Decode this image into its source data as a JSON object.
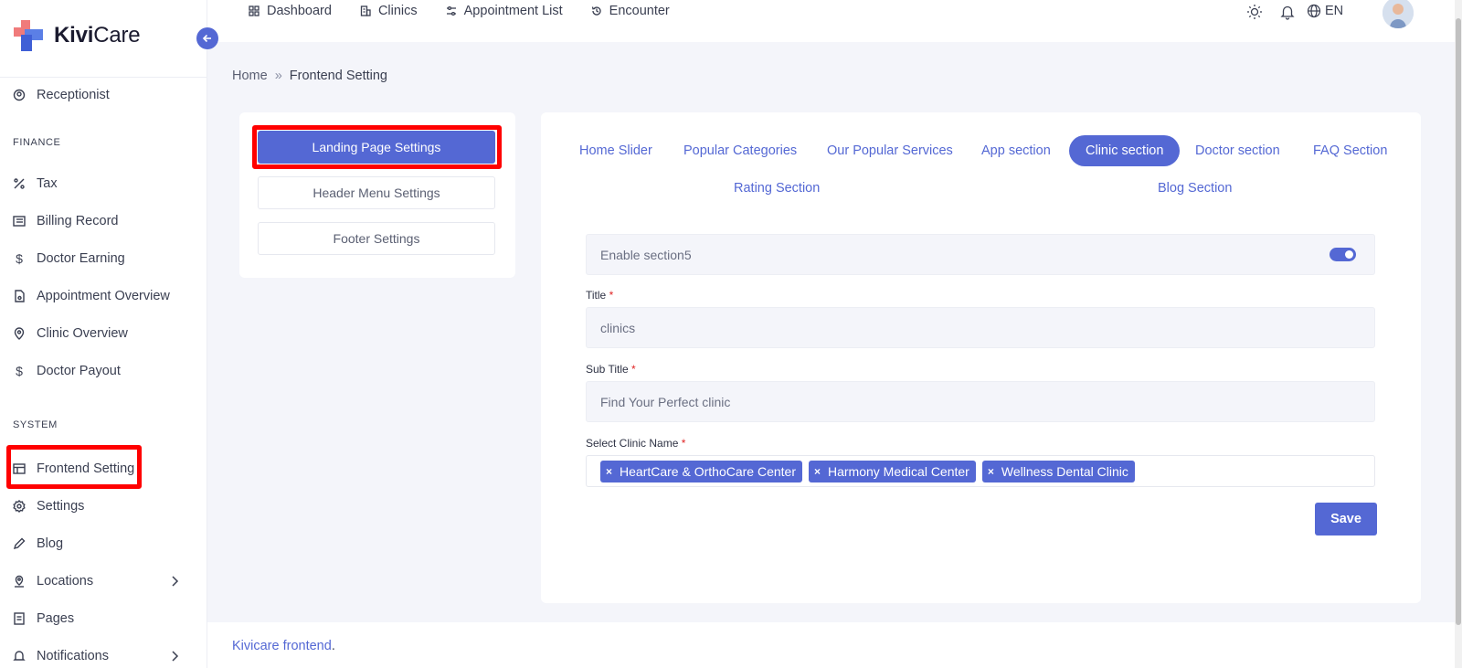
{
  "brand": {
    "name_bold": "Kivi",
    "name_rest": "Care"
  },
  "sidebar": {
    "items": [
      {
        "label": "Receptionist",
        "icon": "receptionist-icon"
      },
      {
        "label": "Tax",
        "icon": "percent-icon"
      },
      {
        "label": "Billing Record",
        "icon": "billing-icon"
      },
      {
        "label": "Doctor Earning",
        "icon": "dollar-icon"
      },
      {
        "label": "Appointment Overview",
        "icon": "document-icon"
      },
      {
        "label": "Clinic Overview",
        "icon": "location-pin-icon"
      },
      {
        "label": "Doctor Payout",
        "icon": "dollar-icon"
      },
      {
        "label": "Frontend Setting",
        "icon": "layout-icon"
      },
      {
        "label": "Settings",
        "icon": "gear-icon"
      },
      {
        "label": "Blog",
        "icon": "pencil-icon"
      },
      {
        "label": "Locations",
        "icon": "map-pin-icon"
      },
      {
        "label": "Pages",
        "icon": "pages-icon"
      },
      {
        "label": "Notifications",
        "icon": "bell-icon"
      }
    ],
    "sections": {
      "finance": "FINANCE",
      "system": "SYSTEM"
    }
  },
  "topnav": {
    "items": [
      {
        "label": "Dashboard",
        "icon": "grid-icon"
      },
      {
        "label": "Clinics",
        "icon": "building-icon"
      },
      {
        "label": "Appointment List",
        "icon": "sliders-icon"
      },
      {
        "label": "Encounter",
        "icon": "history-icon"
      }
    ],
    "lang": "EN"
  },
  "breadcrumb": {
    "home": "Home",
    "current": "Frontend Setting"
  },
  "settings_menu": {
    "landing": "Landing Page Settings",
    "header": "Header Menu Settings",
    "footer": "Footer Settings"
  },
  "tabs": {
    "home_slider": "Home Slider",
    "popular_categories": "Popular Categories",
    "popular_services": "Our Popular Services",
    "app_section": "App section",
    "clinic_section": "Clinic section",
    "doctor_section": "Doctor section",
    "faq_section": "FAQ Section",
    "rating_section": "Rating Section",
    "blog_section": "Blog Section"
  },
  "form": {
    "enable_label": "Enable section5",
    "title_label": "Title",
    "title_value": "clinics",
    "subtitle_label": "Sub Title",
    "subtitle_value": "Find Your Perfect clinic",
    "clinic_label": "Select Clinic Name",
    "required_mark": "*",
    "clinics": [
      "HeartCare & OrthoCare Center",
      "Harmony Medical Center",
      "Wellness Dental Clinic"
    ],
    "chip_remove": "×",
    "save": "Save"
  },
  "footer": {
    "link": "Kivicare frontend",
    "suffix": "."
  },
  "colors": {
    "accent": "#5468d4",
    "highlight": "#ff0000"
  }
}
